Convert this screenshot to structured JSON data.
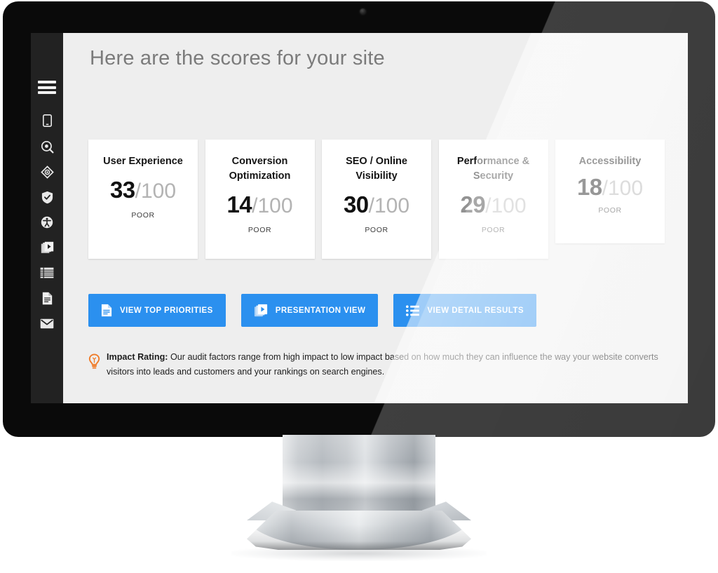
{
  "device": {
    "type": "desktop-monitor",
    "camera": "webcam-dot"
  },
  "sidebar": {
    "menu_label": "Menu",
    "items": [
      {
        "icon": "mobile-icon",
        "label": "Mobile"
      },
      {
        "icon": "target-search-icon",
        "label": "Search Visibility"
      },
      {
        "icon": "eye-target-icon",
        "label": "User Experience"
      },
      {
        "icon": "shield-check-icon",
        "label": "Security"
      },
      {
        "icon": "accessibility-icon",
        "label": "Accessibility"
      },
      {
        "icon": "presentation-icon",
        "label": "Presentation"
      },
      {
        "icon": "list-icon",
        "label": "Detail Results"
      },
      {
        "icon": "document-icon",
        "label": "Report"
      },
      {
        "icon": "envelope-icon",
        "label": "Email"
      }
    ]
  },
  "header": {
    "title": "Here are the scores for your site"
  },
  "scores": {
    "denominator": "/100",
    "cards": [
      {
        "title": "User Experience",
        "score": "33",
        "denominator": "/100",
        "rating": "POOR",
        "lines": 2
      },
      {
        "title": "Conversion Optimization",
        "score": "14",
        "denominator": "/100",
        "rating": "POOR",
        "lines": 2
      },
      {
        "title": "SEO / Online Visibility",
        "score": "30",
        "denominator": "/100",
        "rating": "POOR",
        "lines": 2
      },
      {
        "title": "Performance & Security",
        "score": "29",
        "denominator": "/100",
        "rating": "POOR",
        "lines": 2
      },
      {
        "title": "Accessibility",
        "score": "18",
        "denominator": "/100",
        "rating": "POOR",
        "lines": 1
      }
    ]
  },
  "actions": [
    {
      "label": "VIEW TOP PRIORITIES",
      "icon": "document-icon"
    },
    {
      "label": "PRESENTATION VIEW",
      "icon": "presentation-play-icon"
    },
    {
      "label": "VIEW DETAIL RESULTS",
      "icon": "bulleted-list-icon"
    }
  ],
  "note": {
    "icon": "lightbulb-icon",
    "label": "Impact Rating:",
    "text": " Our audit factors range from high impact to low impact based on how much they can influence the way your website converts visitors into leads and customers and your rankings on search engines."
  },
  "colors": {
    "accent_blue": "#2b90ef",
    "sidebar_dark": "#222222",
    "screen_bg": "#eeeeee",
    "card_bg": "#ffffff",
    "title_gray": "#7b7b7b",
    "denominator_gray": "#b3b3b3",
    "lightbulb_orange": "#f07b28",
    "bezel_black": "#0a0a0a"
  }
}
